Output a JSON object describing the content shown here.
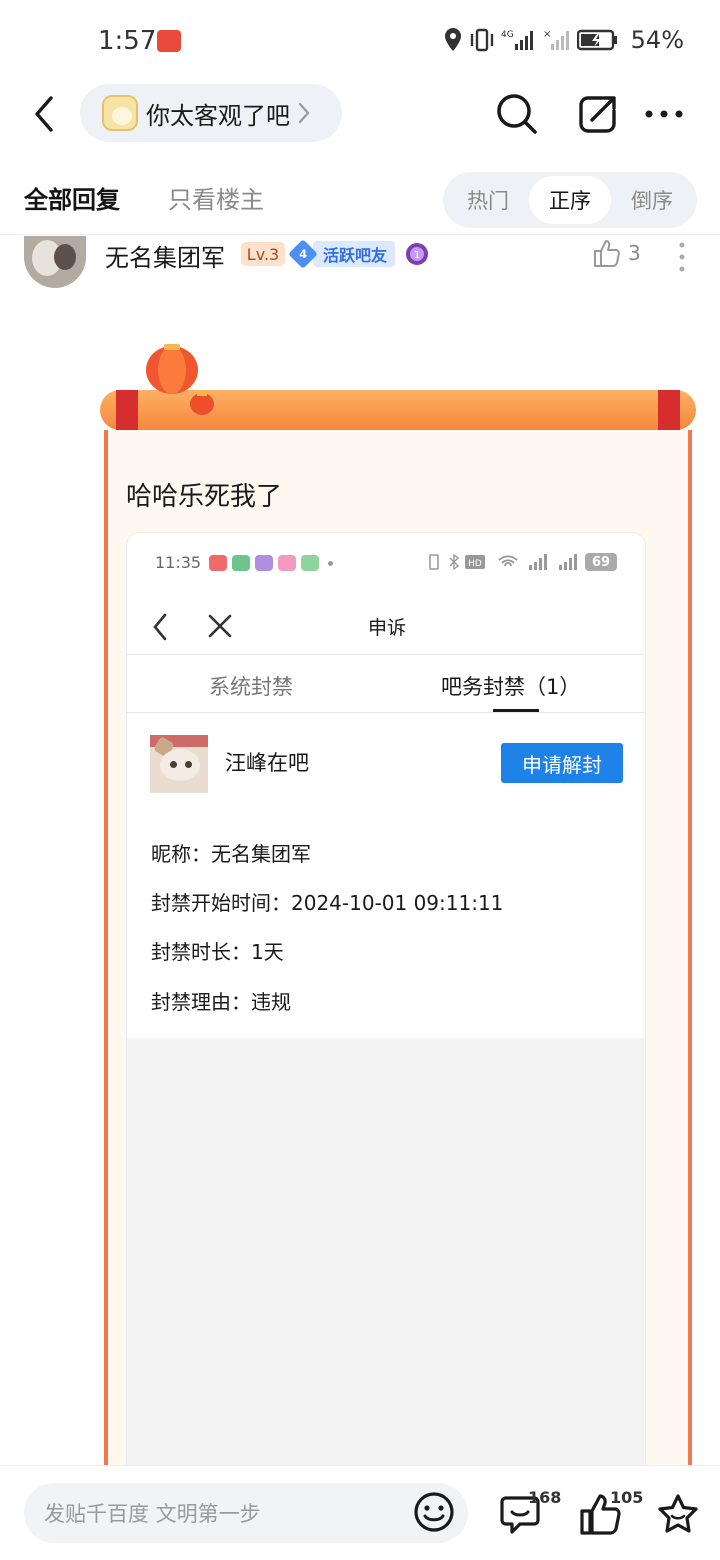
{
  "status_bar": {
    "time": "1:57",
    "battery": "54%"
  },
  "nav": {
    "forum_name": "你太客观了吧"
  },
  "tabs": {
    "all_replies": "全部回复",
    "op_only": "只看楼主",
    "sort": [
      "热门",
      "正序",
      "倒序"
    ],
    "active_sort": "正序"
  },
  "post": {
    "author": "无名集团军",
    "level": "Lv.3",
    "active_level": "4",
    "active_label": "活跃吧友",
    "likes": "3",
    "text": "哈哈乐死我了"
  },
  "screenshot": {
    "time": "11:35",
    "battery": "69",
    "title": "申诉",
    "tab_system": "系统封禁",
    "tab_forum": "吧务封禁（1）",
    "forum_name": "汪峰在吧",
    "unban_button": "申请解封",
    "nickname": "昵称：无名集团军",
    "ban_start": "封禁开始时间：2024-10-01 09:11:11",
    "ban_duration": "封禁时长：1天",
    "ban_reason": "封禁理由：违规"
  },
  "bottom_bar": {
    "placeholder": "发贴千百度 文明第一步",
    "comment_count": "168",
    "like_count": "105"
  },
  "colors": {
    "accent_blue": "#1f82e9",
    "scroll_orange": "#f6883d",
    "scroll_red": "#d62e2e"
  }
}
